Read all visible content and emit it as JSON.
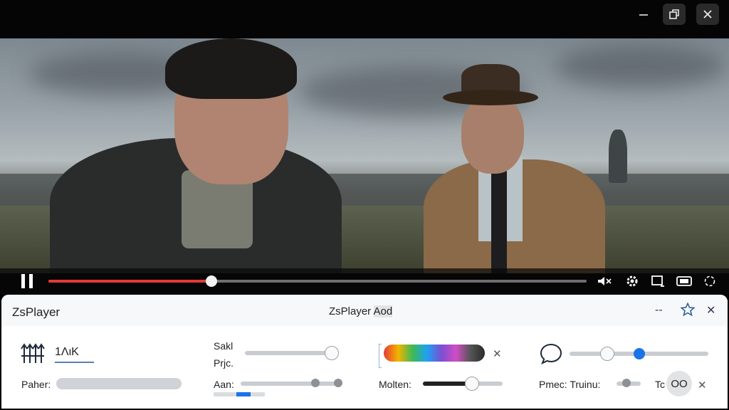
{
  "window": {
    "minimize_label": "–",
    "close_label": "✕",
    "icons": [
      "minimize-icon",
      "restore-icon",
      "close-icon"
    ]
  },
  "player": {
    "progress": 0.3025,
    "controls_icons": [
      "pause-icon",
      "volume-icon",
      "settings-gear-icon",
      "miniplayer-icon",
      "theater-icon",
      "fullscreen-icon"
    ],
    "accent_color": "#e53935"
  },
  "panel": {
    "title": "ZsPlayer",
    "center_title_part1": "ZsPlayer ",
    "center_title_part2": "Aod",
    "collapse_label": "--",
    "close_label": "✕",
    "equalizer_value": "1ΛιK",
    "paher_label": "Paher:",
    "sakl_label": "Sakl",
    "prjc_label": "Prjc.",
    "aan_label": "Aan:",
    "molten_label": "Molten:",
    "pmec_label": "Pmec: Truinu:",
    "tc_label": "Tc",
    "oo_label": "OO",
    "x_label": "✕",
    "sliders": {
      "sakl": 0.94,
      "aan": 0.76,
      "molten": 0.62,
      "chat_a": 0.27,
      "chat_b": 0.5,
      "truinu": 0.45
    },
    "colors": {
      "accent_blue": "#1a73e8",
      "slider_track": "#c9ccd1",
      "molten_fill": "#222222"
    }
  }
}
